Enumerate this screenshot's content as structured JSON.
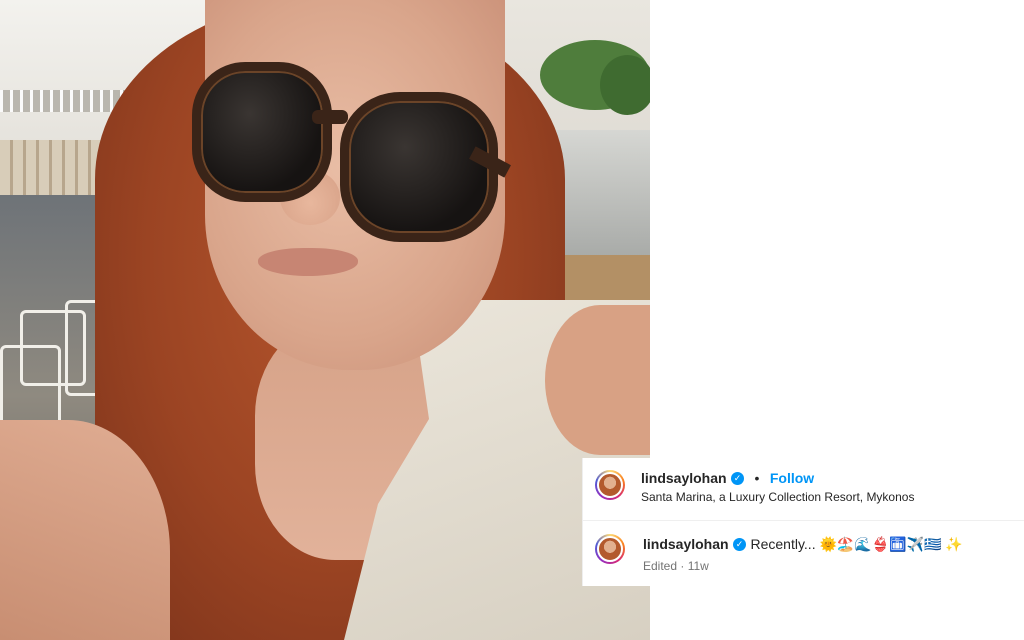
{
  "post": {
    "header": {
      "username": "lindsaylohan",
      "separator": "•",
      "follow_label": "Follow",
      "location": "Santa Marina, a Luxury Collection Resort, Mykonos"
    },
    "caption": {
      "username": "lindsaylohan",
      "text": "Recently... 🌞🏖️🌊👙🛅✈️🇬🇷 ✨",
      "edited_label": "Edited",
      "dot": "·",
      "age": "11w"
    }
  },
  "icons": {
    "verified": "verified-badge-icon",
    "avatar": "avatar"
  },
  "colors": {
    "link_blue": "#0095f6",
    "text": "#262626",
    "muted": "#737373"
  }
}
